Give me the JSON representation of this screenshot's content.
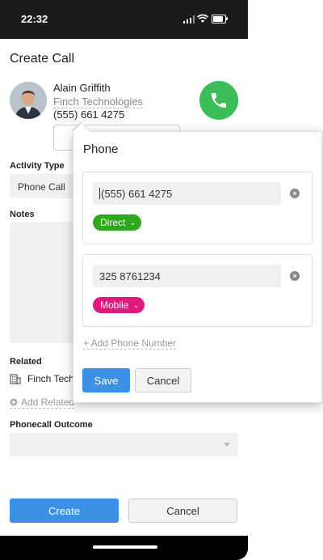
{
  "status_bar": {
    "time": "22:32"
  },
  "form": {
    "title": "Create Call",
    "contact": {
      "name": "Alain Griffith",
      "company": "Finch Technologies",
      "phone": "(555) 661 4275"
    },
    "activity_type_label": "Activity Type",
    "activity_type_value": "Phone Call",
    "notes_label": "Notes",
    "related_label": "Related",
    "related_item": "Finch Tech",
    "add_related": "Add Related",
    "outcome_label": "Phonecall Outcome",
    "outcome_value": "",
    "create_label": "Create",
    "cancel_label": "Cancel"
  },
  "popover": {
    "title": "Phone",
    "phones": [
      {
        "number": "(555) 661 4275",
        "type": "Direct",
        "color": "#2ea81f"
      },
      {
        "number": "325 8761234",
        "type": "Mobile",
        "color": "#e0197d"
      }
    ],
    "add_phone_label": "+ Add Phone Number",
    "save_label": "Save",
    "cancel_label": "Cancel"
  },
  "colors": {
    "accent": "#3c91e6",
    "call_green": "#3dbd5a"
  },
  "icons": [
    "signal-icon",
    "wifi-icon",
    "battery-icon",
    "phone-handset-icon",
    "building-icon",
    "plus-circle-icon",
    "clear-icon",
    "chevron-down-icon"
  ]
}
